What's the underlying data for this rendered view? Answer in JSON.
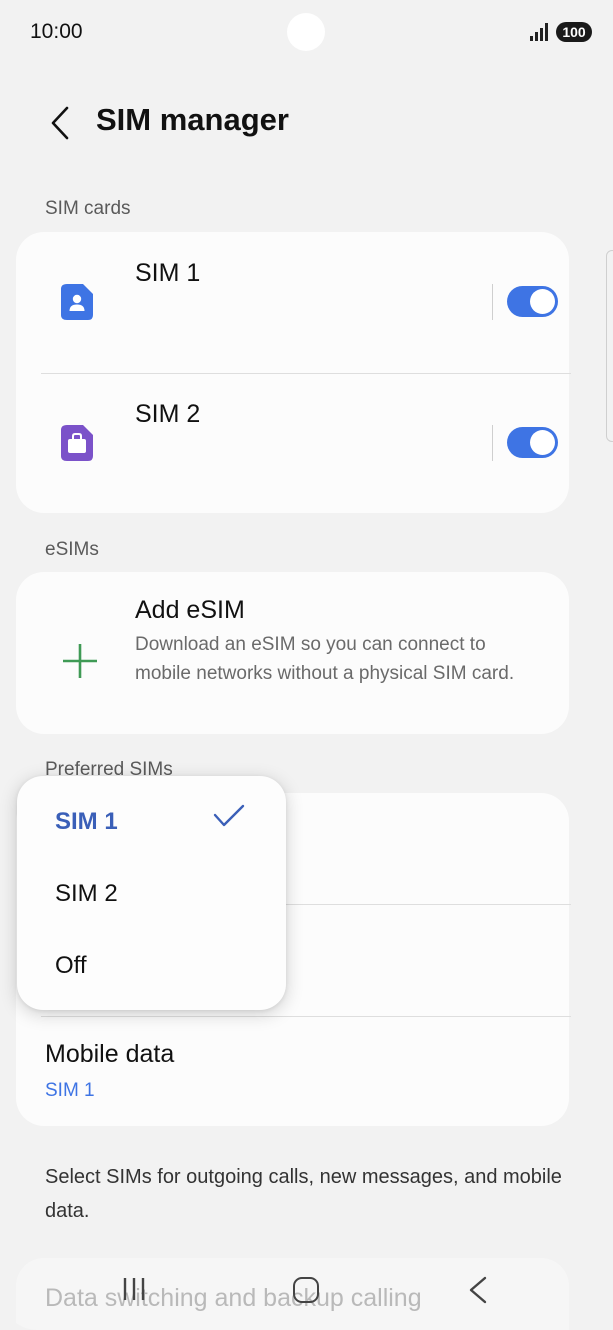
{
  "status_bar": {
    "time": "10:00",
    "battery": "100"
  },
  "header": {
    "title": "SIM manager"
  },
  "sim_cards": {
    "section_label": "SIM cards",
    "items": [
      {
        "name": "SIM 1",
        "icon": "person-sim-icon",
        "icon_color": "#3e74e4",
        "enabled": true
      },
      {
        "name": "SIM 2",
        "icon": "work-sim-icon",
        "icon_color": "#7b52c9",
        "enabled": true
      }
    ]
  },
  "esims": {
    "section_label": "eSIMs",
    "add_title": "Add eSIM",
    "add_description": "Download an eSIM so you can connect to mobile networks without a physical SIM card.",
    "add_icon_color": "#3f9a55"
  },
  "preferred_sims": {
    "section_label": "Preferred SIMs",
    "mobile_data_title": "Mobile data",
    "mobile_data_value": "SIM 1"
  },
  "dropdown": {
    "options": [
      "SIM 1",
      "SIM 2",
      "Off"
    ],
    "selected": "SIM 1"
  },
  "footnote": "Select SIMs for outgoing calls, new messages, and mobile data.",
  "bottom_item": {
    "title": "Data switching and backup calling"
  },
  "colors": {
    "accent": "#3e74e4",
    "background": "#f2f2f2",
    "card": "#fcfcfc"
  }
}
